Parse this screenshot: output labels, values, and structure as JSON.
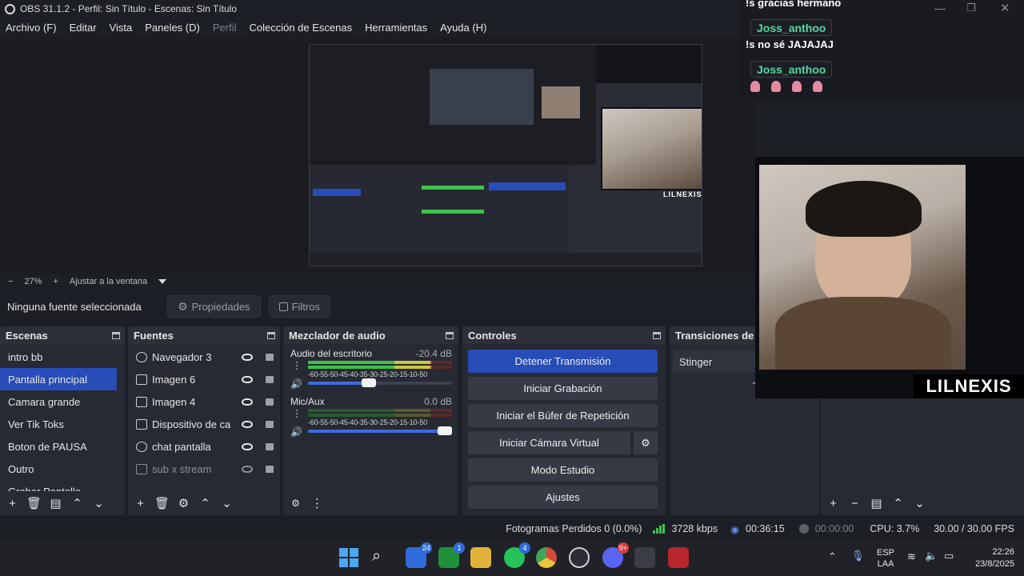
{
  "window": {
    "title": "OBS 31.1.2 - Perfil: Sin Título - Escenas: Sin Título"
  },
  "menu": [
    {
      "label": "Archivo (F)",
      "enabled": true
    },
    {
      "label": "Editar",
      "enabled": true
    },
    {
      "label": "Vista",
      "enabled": true
    },
    {
      "label": "Paneles (D)",
      "enabled": true
    },
    {
      "label": "Perfil",
      "enabled": false
    },
    {
      "label": "Colección de Escenas",
      "enabled": true
    },
    {
      "label": "Herramientas",
      "enabled": true
    },
    {
      "label": "Ayuda (H)",
      "enabled": true
    }
  ],
  "zoom": {
    "minus": "−",
    "value": "27%",
    "plus": "+",
    "fit_label": "Ajustar a la ventana"
  },
  "source_toolbar": {
    "no_selection": "Ninguna fuente seleccionada",
    "properties": "Propiedades",
    "filters": "Filtros"
  },
  "scenes": {
    "title": "Escenas",
    "items": [
      "intro bb",
      "Pantalla principal",
      "Camara grande",
      "Ver Tik Toks",
      "Boton de PAUSA",
      "Outro",
      "Grabar Pantalla"
    ],
    "selected_index": 1
  },
  "sources": {
    "title": "Fuentes",
    "items": [
      {
        "name": "Navegador 3",
        "icon": "globe-icon",
        "visible": true
      },
      {
        "name": "Imagen 6",
        "icon": "image-icon",
        "visible": true
      },
      {
        "name": "Imagen 4",
        "icon": "image-icon",
        "visible": true
      },
      {
        "name": "Dispositivo de captura de video",
        "icon": "camera-icon",
        "visible": true
      },
      {
        "name": "chat pantalla",
        "icon": "globe-icon",
        "visible": true
      },
      {
        "name": "sub x stream",
        "icon": "image-icon",
        "visible": false
      }
    ]
  },
  "mixer": {
    "title": "Mezclador de audio",
    "scale": [
      "-60",
      "-55",
      "-50",
      "-45",
      "-40",
      "-35",
      "-30",
      "-25",
      "-20",
      "-15",
      "-10",
      "-5",
      "0"
    ],
    "channels": [
      {
        "name": "Audio del escritorio",
        "db": "-20.4 dB",
        "level": 0.86,
        "fader": 0.47
      },
      {
        "name": "Mic/Aux",
        "db": "0.0 dB",
        "level": 0.0,
        "fader": 1.0
      }
    ]
  },
  "controls": {
    "title": "Controles",
    "stop_stream": "Detener Transmisión",
    "start_recording": "Iniciar Grabación",
    "replay_buffer": "Iniciar el Búfer de Repetición",
    "virtual_camera": "Iniciar Cámara Virtual",
    "studio_mode": "Modo Estudio",
    "settings": "Ajustes"
  },
  "transitions": {
    "title": "Transiciones de escena",
    "current": "Stinger"
  },
  "status": {
    "dropped_frames": "Fotogramas Perdidos 0 (0.0%)",
    "bitrate": "3728 kbps",
    "stream_time": "00:36:15",
    "record_time": "00:00:00",
    "cpu": "CPU: 3.7%",
    "fps": "30.00 / 30.00 FPS"
  },
  "chat": {
    "messages": [
      {
        "user": "",
        "text": "!s gracias hermano"
      },
      {
        "user": "Joss_anthoo",
        "text": "!s no sé JAJAJAJ"
      },
      {
        "user": "Joss_anthoo",
        "text": ""
      }
    ]
  },
  "webcam": {
    "label": "LILNEXIS"
  },
  "nested_preview": {
    "label": "LILNEXIS"
  },
  "taskbar": {
    "badges": {
      "phone_link": "24",
      "xbox": "1",
      "whatsapp": "4",
      "discord": "9+"
    },
    "language": "ESP",
    "layout": "LAA",
    "time": "22:26",
    "date": "23/8/2025"
  },
  "colors": {
    "accent": "#284cb8",
    "panel": "#272a33",
    "chat_name": "#55d6a4",
    "meter_green": "#3ec24a",
    "meter_yellow": "#c9c93a",
    "meter_red": "#c83a3a"
  }
}
